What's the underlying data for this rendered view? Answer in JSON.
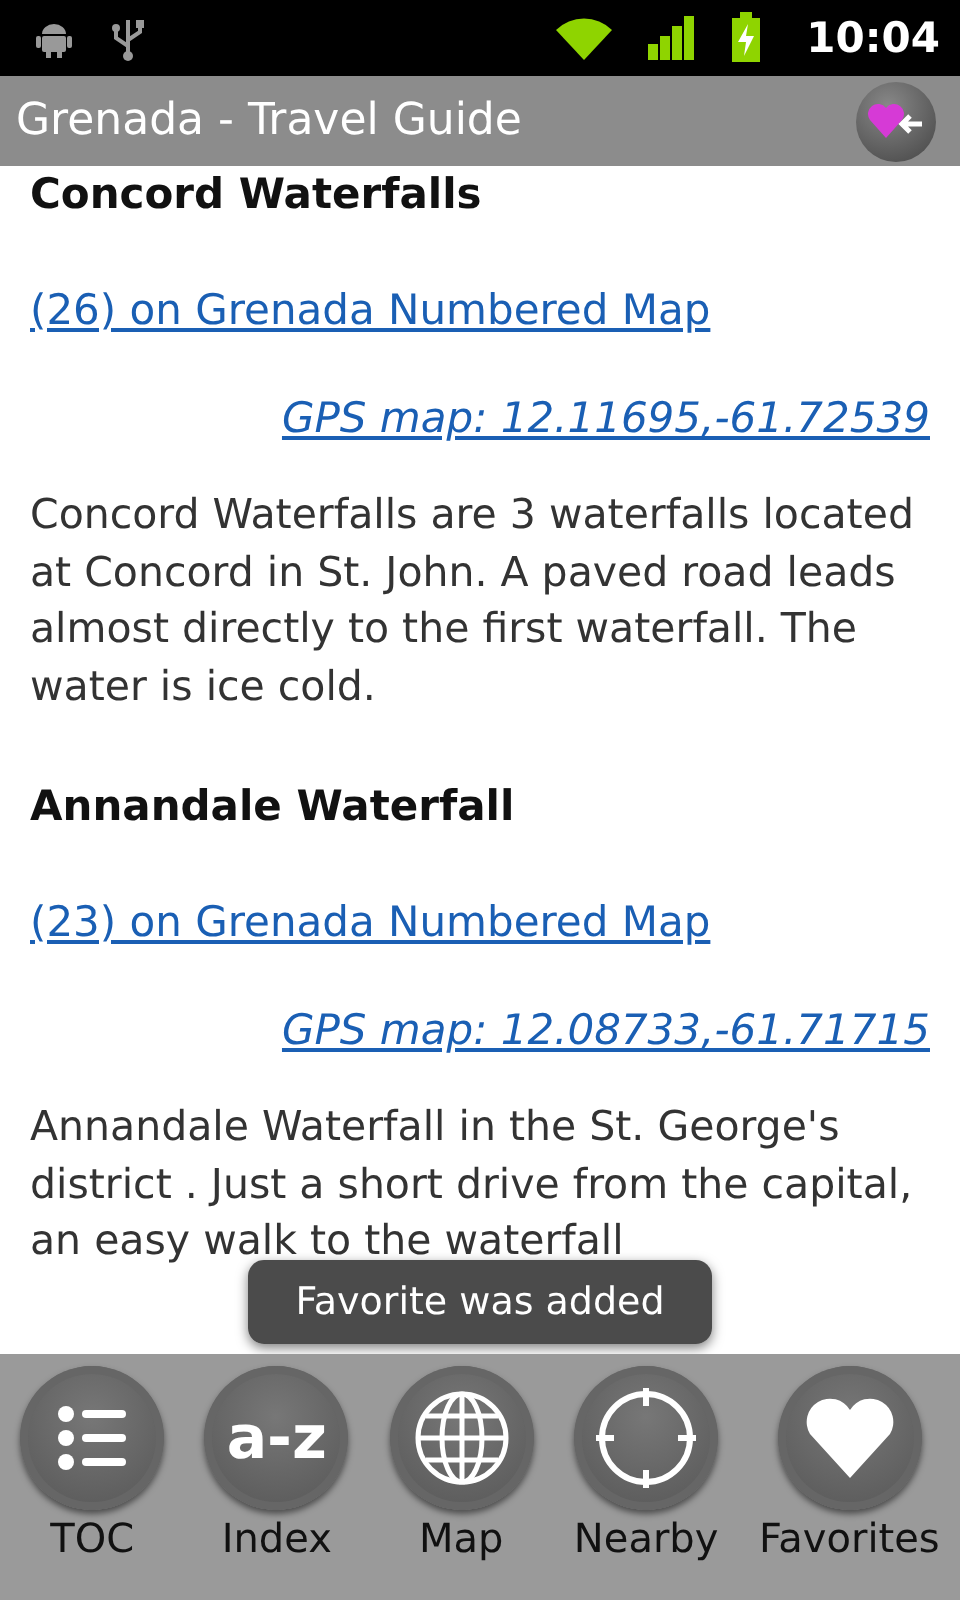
{
  "status_bar": {
    "time": "10:04"
  },
  "title_bar": {
    "title": "Grenada - Travel Guide"
  },
  "sections": [
    {
      "heading": "Concord Waterfalls",
      "map_link": "(26) on Grenada Numbered Map",
      "gps_link": "GPS map: 12.11695,-61.72539",
      "text": "Concord Waterfalls are 3 waterfalls located at Concord in St. John. A paved road leads almost directly to the first waterfall. The water is ice cold."
    },
    {
      "heading": "Annandale Waterfall",
      "map_link": "(23) on Grenada Numbered Map",
      "gps_link": "GPS map: 12.08733,-61.71715",
      "text": "Annandale Waterfall in the St. George's district . Just a short drive from the capital, an easy walk to the waterfall"
    }
  ],
  "toast": "Favorite was added",
  "bottom_bar": [
    {
      "kind": "toc",
      "label": "TOC"
    },
    {
      "kind": "index",
      "label": "Index",
      "icon_text": "a-z"
    },
    {
      "kind": "map",
      "label": "Map"
    },
    {
      "kind": "nearby",
      "label": "Nearby"
    },
    {
      "kind": "favorites",
      "label": "Favorites"
    }
  ]
}
